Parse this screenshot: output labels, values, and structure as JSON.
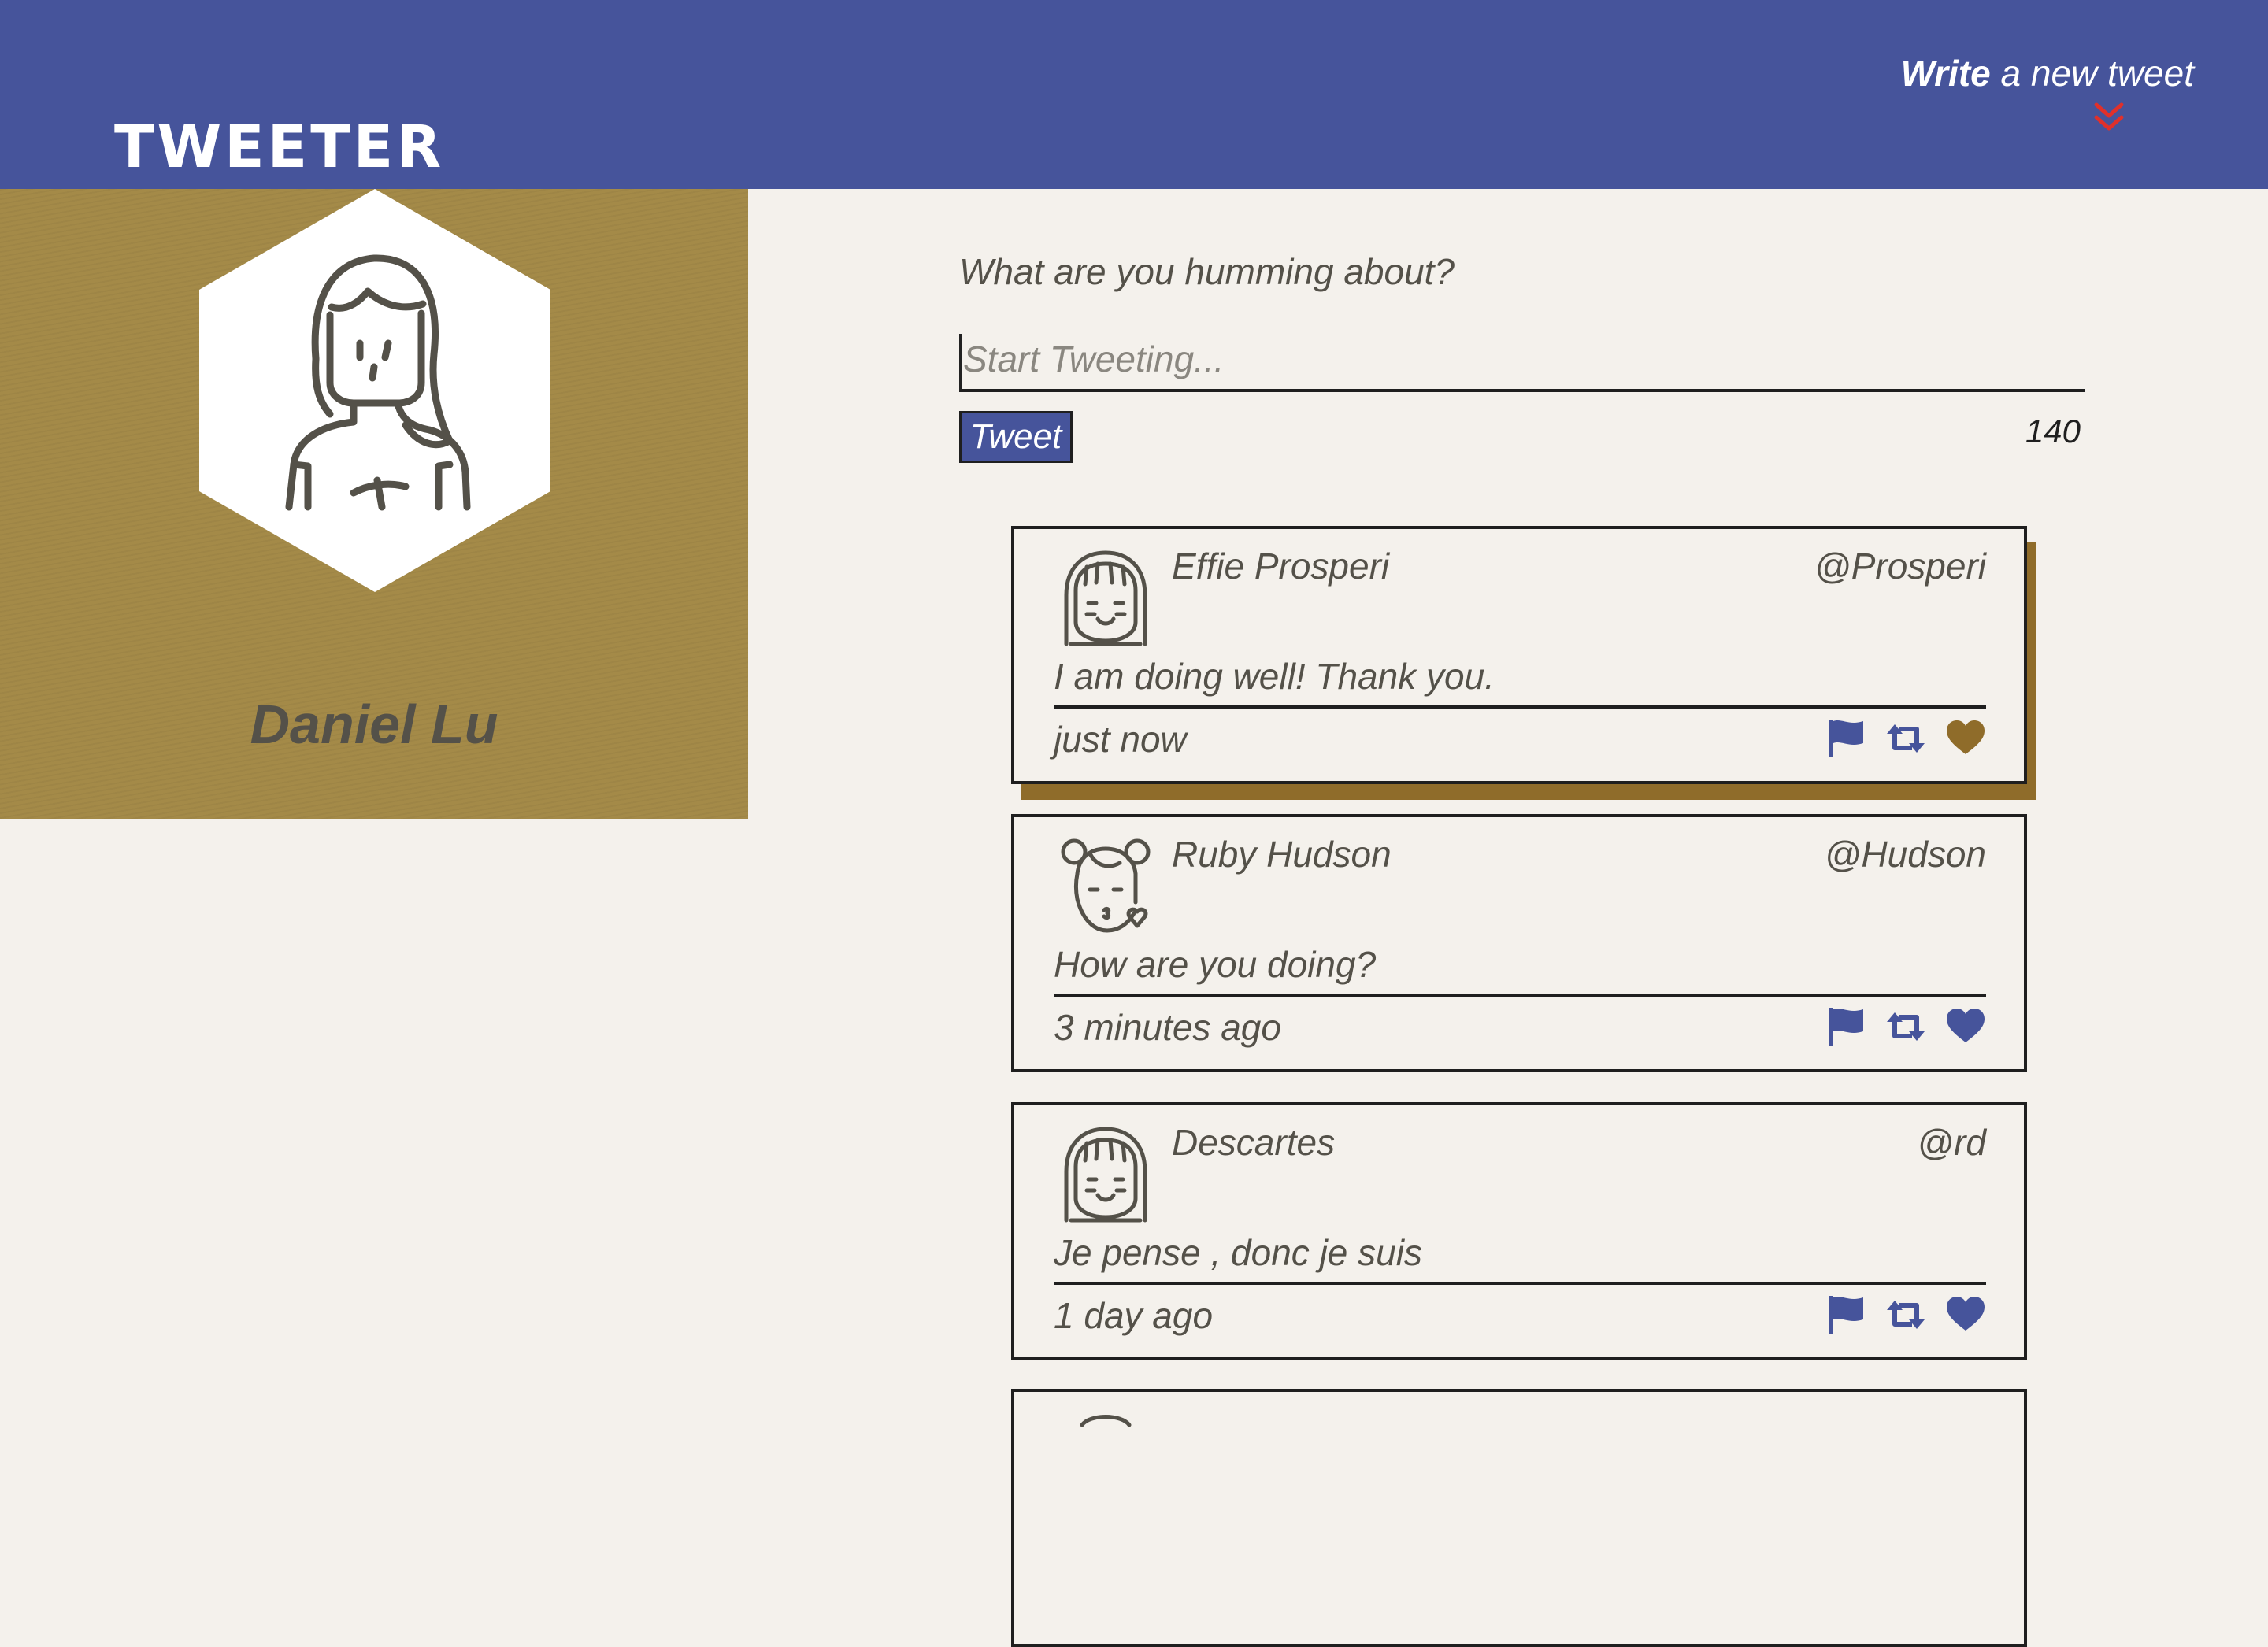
{
  "header": {
    "brand": "TWEETER",
    "compose_bold": "Write",
    "compose_rest": " a new tweet",
    "background_color": "#46549b",
    "chevron_color": "#e0302b"
  },
  "profile": {
    "name": "Daniel Lu",
    "background_color": "#a48a48",
    "avatar_icon": "woman-avatar-icon"
  },
  "composer": {
    "prompt": "What are you humming about?",
    "placeholder": "Start Tweeting...",
    "button_label": "Tweet",
    "counter": "140"
  },
  "tweets": [
    {
      "name": "Effie Prosperi",
      "handle": "@Prosperi",
      "content": "I am doing well! Thank you.",
      "time": "just now",
      "avatar_icon": "girl-bangs-avatar-icon",
      "like_color": "#8f6c2a"
    },
    {
      "name": "Ruby Hudson",
      "handle": "@Hudson",
      "content": "How are you doing?",
      "time": "3 minutes ago",
      "avatar_icon": "girl-kiss-avatar-icon",
      "like_color": "#46549b"
    },
    {
      "name": "Descartes",
      "handle": "@rd",
      "content": "Je pense , donc je suis",
      "time": "1 day ago",
      "avatar_icon": "girl-bangs-avatar-icon",
      "like_color": "#46549b"
    }
  ],
  "colors": {
    "accent": "#46549b",
    "gold": "#8f6c2a",
    "page_bg": "#f4f1ec"
  }
}
